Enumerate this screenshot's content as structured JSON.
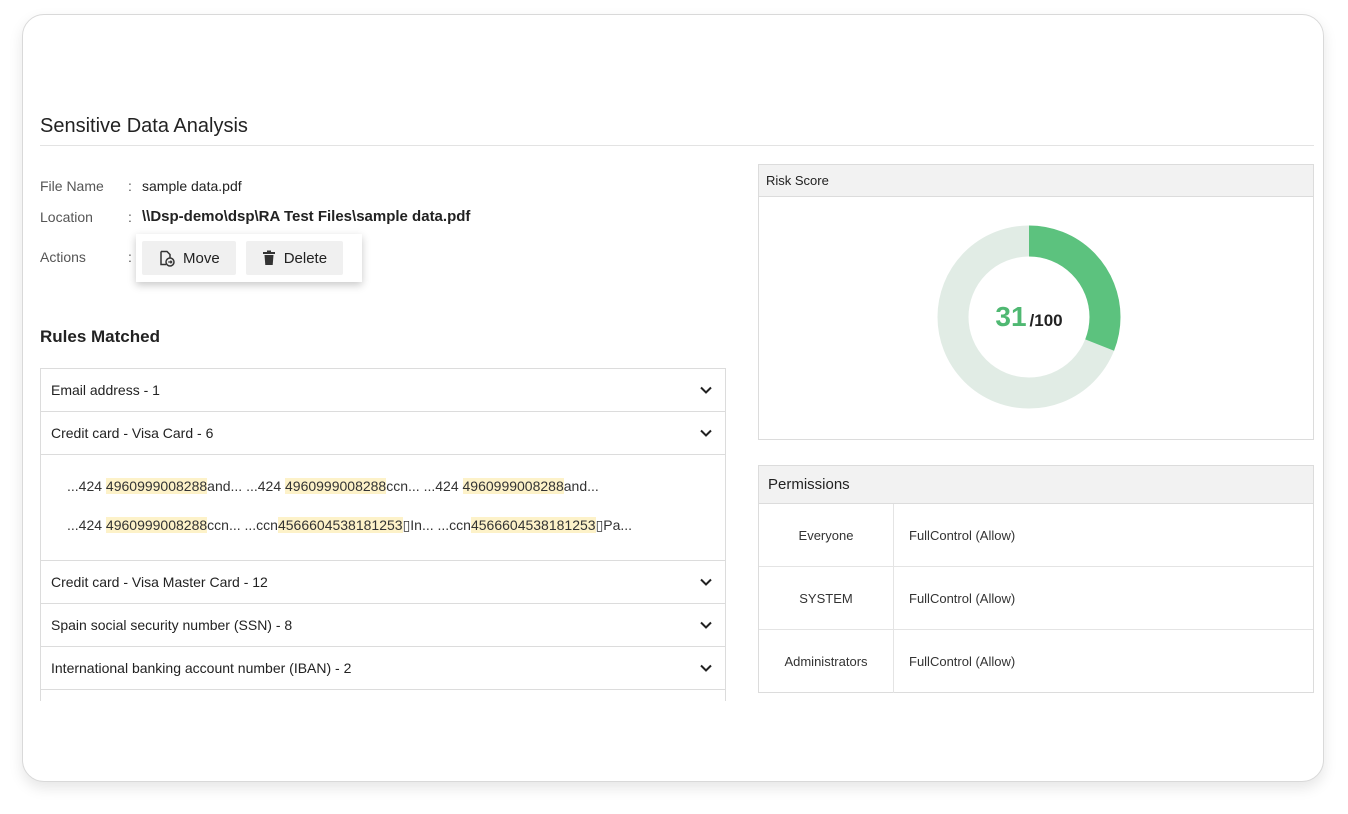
{
  "page": {
    "title": "Sensitive Data Analysis"
  },
  "file_info": {
    "file_name_label": "File Name",
    "file_name_value": "sample data.pdf",
    "location_label": "Location",
    "location_value": "\\\\Dsp-demo\\dsp\\RA Test Files\\sample data.pdf",
    "actions_label": "Actions",
    "colon": ":"
  },
  "actions": {
    "move_label": "Move",
    "delete_label": "Delete",
    "move_icon": "move-file-icon",
    "delete_icon": "trash-icon"
  },
  "rules": {
    "title": "Rules Matched",
    "items": [
      {
        "label": "Email address - 1"
      },
      {
        "label": "Credit card - Visa Card - 6"
      },
      {
        "label": "Credit card - Visa Master Card - 12"
      },
      {
        "label": "Spain social security number (SSN) - 8"
      },
      {
        "label": "International banking account number (IBAN) - 2"
      }
    ],
    "expanded_snippets": [
      [
        {
          "pre": "...424 ",
          "hit": "4960999008288",
          "post": "and... "
        },
        {
          "pre": "...424 ",
          "hit": "4960999008288",
          "post": "ccn... "
        },
        {
          "pre": "...424 ",
          "hit": "4960999008288",
          "post": "and..."
        }
      ],
      [
        {
          "pre": "...424 ",
          "hit": "4960999008288",
          "post": "ccn... "
        },
        {
          "pre": "...ccn",
          "hit": "4566604538181253",
          "post": "▯In... "
        },
        {
          "pre": "...ccn",
          "hit": "4566604538181253",
          "post": "▯Pa..."
        }
      ]
    ]
  },
  "risk": {
    "title": "Risk Score",
    "score": "31",
    "max": "/100",
    "score_fraction": 0.31,
    "fill_color": "#5cc27e",
    "track_color": "#e1ece5"
  },
  "permissions": {
    "title": "Permissions",
    "rows": [
      {
        "who": "Everyone",
        "what": "FullControl (Allow)"
      },
      {
        "who": "SYSTEM",
        "what": "FullControl (Allow)"
      },
      {
        "who": "Administrators",
        "what": "FullControl (Allow)"
      }
    ]
  },
  "colors": {
    "accent_green": "#4fb872",
    "highlight": "#fdf2c9"
  }
}
